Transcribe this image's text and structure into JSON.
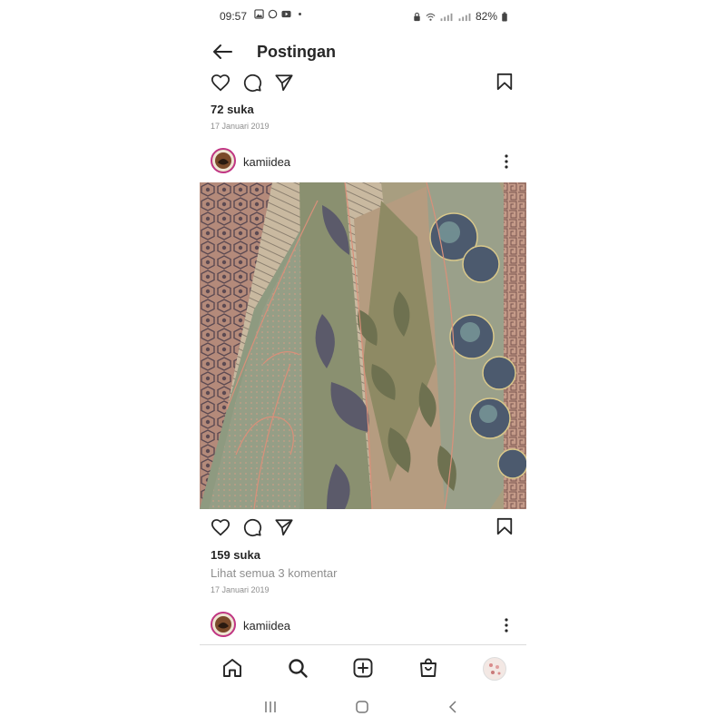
{
  "status_bar": {
    "time": "09:57",
    "battery": "82%",
    "left_icons": [
      "gallery-icon",
      "whatsapp-icon",
      "youtube-icon",
      "dot-icon"
    ],
    "right_icons": [
      "lock-icon",
      "wifi-icon",
      "signal-icon",
      "signal-icon",
      "battery-icon"
    ]
  },
  "header": {
    "title": "Postingan"
  },
  "posts": [
    {
      "likes": "72 suka",
      "date": "17 Januari 2019"
    },
    {
      "username": "kamiidea",
      "likes": "159 suka",
      "comments": "Lihat semua 3 komentar",
      "date": "17 Januari 2019"
    },
    {
      "username": "kamiidea"
    }
  ],
  "nav": [
    "home",
    "search",
    "create",
    "shop",
    "profile"
  ],
  "colors": {
    "text": "#262626",
    "muted": "#8e8e8e",
    "story_ring": "#c13584",
    "divider": "#dbdbdb"
  }
}
